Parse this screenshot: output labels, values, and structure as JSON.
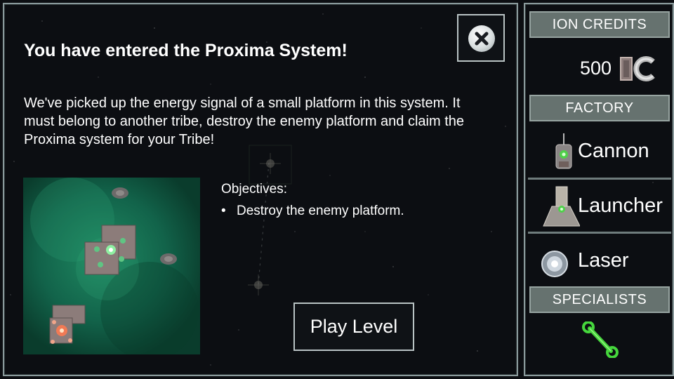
{
  "dialog": {
    "title": "You have entered the Proxima System!",
    "description": "We've picked up the energy signal of a small platform in this system. It must belong to another tribe, destroy the enemy platform and claim the Proxima system for your Tribe!",
    "objectives_heading": "Objectives:",
    "objectives": [
      "Destroy the enemy platform."
    ],
    "play_button": "Play Level",
    "close_icon": "close-icon"
  },
  "sidebar": {
    "credits_header": "ION CREDITS",
    "credits_value": "500",
    "credits_icon": "ion-credits-icon",
    "factory_header": "FACTORY",
    "factory_items": [
      {
        "label": "Cannon",
        "icon": "cannon-icon"
      },
      {
        "label": "Launcher",
        "icon": "launcher-icon"
      },
      {
        "label": "Laser",
        "icon": "laser-icon"
      }
    ],
    "specialists_header": "SPECIALISTS",
    "specialists_icon": "wrench-icon"
  },
  "colors": {
    "background": "#0c0e12",
    "panel_border": "#8a9a9c",
    "header_fill": "#66726f",
    "map_green": "#0d4a36",
    "accent_green": "#45d63c"
  }
}
